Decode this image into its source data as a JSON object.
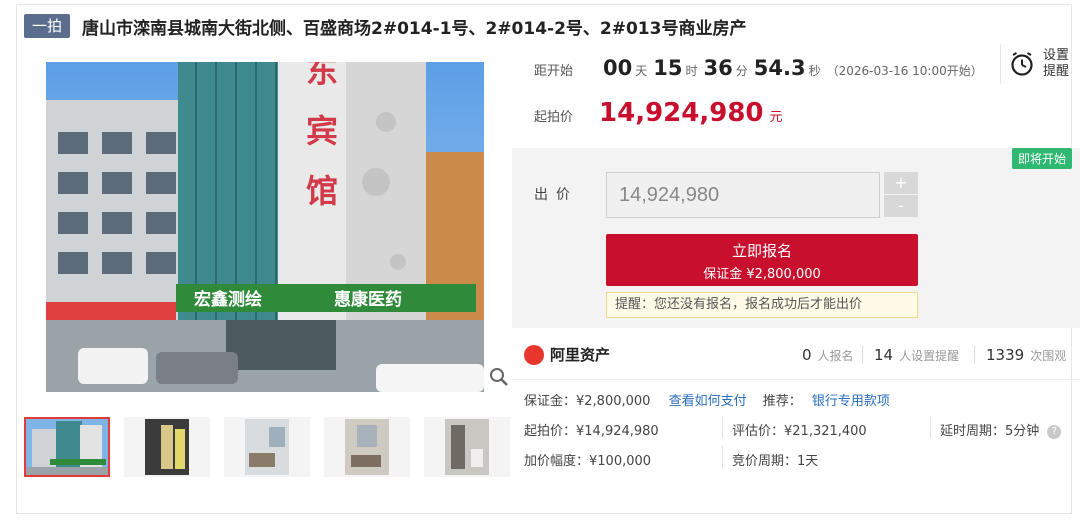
{
  "header": {
    "badge": "一拍",
    "title": "唐山市滦南县城南大街北侧、百盛商场2#014-1号、2#014-2号、2#013号商业房产"
  },
  "building": {
    "sign_vertical": "东宾馆",
    "shop_sign_1": "宏鑫测绘",
    "shop_sign_2": "惠康医药"
  },
  "countdown": {
    "label": "距开始",
    "days": "00",
    "days_unit": "天",
    "hours": "15",
    "hours_unit": "时",
    "minutes": "36",
    "minutes_unit": "分",
    "seconds": "54.3",
    "seconds_unit": "秒",
    "start_time": "（2026-03-16 10:00开始）"
  },
  "reminder": {
    "label": "设置提醒",
    "icon": "alarm-clock-icon"
  },
  "start_price": {
    "label": "起拍价",
    "value": "14,924,980",
    "unit": "元"
  },
  "bid": {
    "status_badge": "即将开始",
    "label": "出价",
    "input_value": "14,924,980",
    "plus": "+",
    "minus": "-",
    "signup_label": "立即报名",
    "deposit_line": "保证金 ¥2,800,000",
    "tip": "提醒：您还没有报名，报名成功后才能出价"
  },
  "platform": {
    "name": "阿里资产"
  },
  "stats": [
    {
      "num": "0",
      "label": "人报名"
    },
    {
      "num": "14",
      "label": "人设置提醒"
    },
    {
      "num": "1339",
      "label": "次围观"
    }
  ],
  "details": {
    "deposit": "保证金：¥2,800,000",
    "how_to_pay": "查看如何支付",
    "recommend_label": "推荐：",
    "recommend_link": "银行专用款项",
    "start_price": "起拍价：¥14,924,980",
    "appraisal": "评估价：¥21,321,400",
    "delay": "延时周期：5分钟",
    "increment": "加价幅度：¥100,000",
    "bid_period": "竞价周期：1天"
  },
  "colors": {
    "accent_red": "#c8102e",
    "badge_green": "#2eb872",
    "link_blue": "#2a6ebd"
  }
}
